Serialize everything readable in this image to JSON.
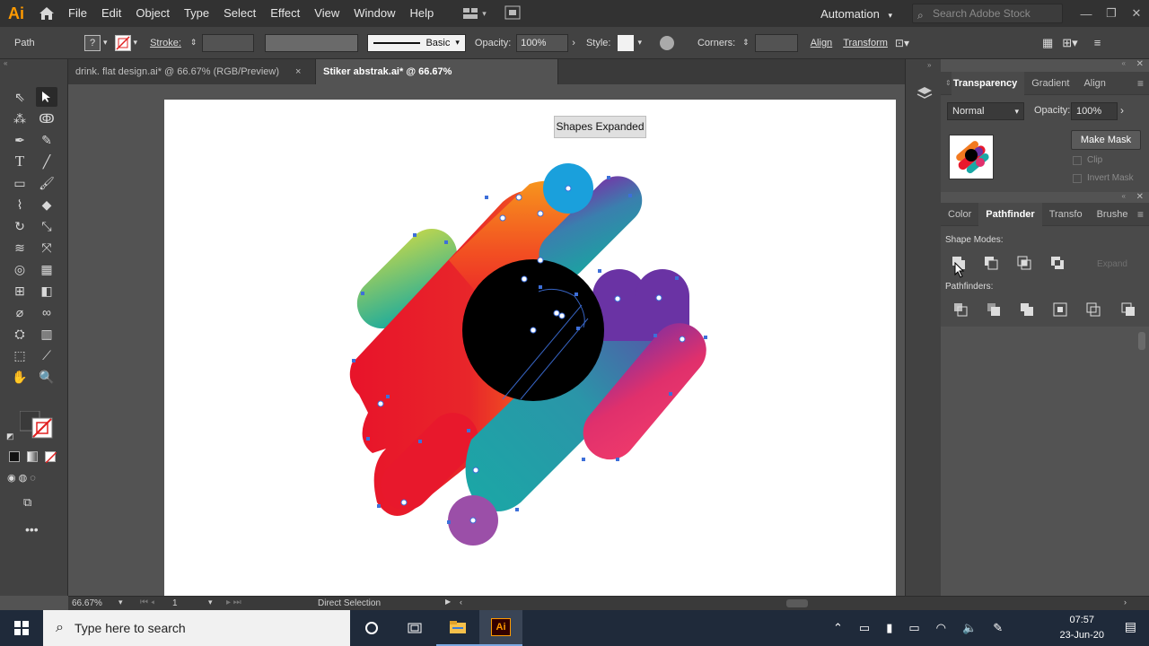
{
  "app": {
    "logo": "Ai",
    "menu": [
      "File",
      "Edit",
      "Object",
      "Type",
      "Select",
      "Effect",
      "View",
      "Window",
      "Help"
    ],
    "workspace": "Automation",
    "search_placeholder": "Search Adobe Stock"
  },
  "control_bar": {
    "selection_type": "Path",
    "stroke_label": "Stroke:",
    "brush_label": "Basic",
    "opacity_label": "Opacity:",
    "opacity_value": "100%",
    "style_label": "Style:",
    "corners_label": "Corners:",
    "align_link": "Align",
    "transform_link": "Transform"
  },
  "tabs": [
    {
      "label": "drink. flat design.ai* @ 66.67% (RGB/Preview)",
      "close": "×",
      "active": false
    },
    {
      "label": "Stiker abstrak.ai* @ 66.67% (CMYK/Preview)",
      "close": "×",
      "active": true
    }
  ],
  "canvas": {
    "tooltip": "Shapes Expanded"
  },
  "transparency_panel": {
    "tabs": [
      "Transparency",
      "Gradient",
      "Align"
    ],
    "blend_mode": "Normal",
    "opacity_label": "Opacity:",
    "opacity_value": "100%",
    "make_mask": "Make Mask",
    "clip": "Clip",
    "invert_mask": "Invert Mask"
  },
  "pathfinder_panel": {
    "tabs": [
      "Color",
      "Pathfinder",
      "Transfo",
      "Brushe"
    ],
    "shape_modes_label": "Shape Modes:",
    "expand": "Expand",
    "pathfinders_label": "Pathfinders:"
  },
  "status_bar": {
    "zoom": "66.67%",
    "artboard": "1",
    "tool": "Direct Selection"
  },
  "taskbar": {
    "search_placeholder": "Type here to search",
    "time": "07:57",
    "date": "23-Jun-20"
  },
  "colors": {
    "accent_orange": "#ff9a00",
    "selection_blue": "#3d6fd9"
  }
}
